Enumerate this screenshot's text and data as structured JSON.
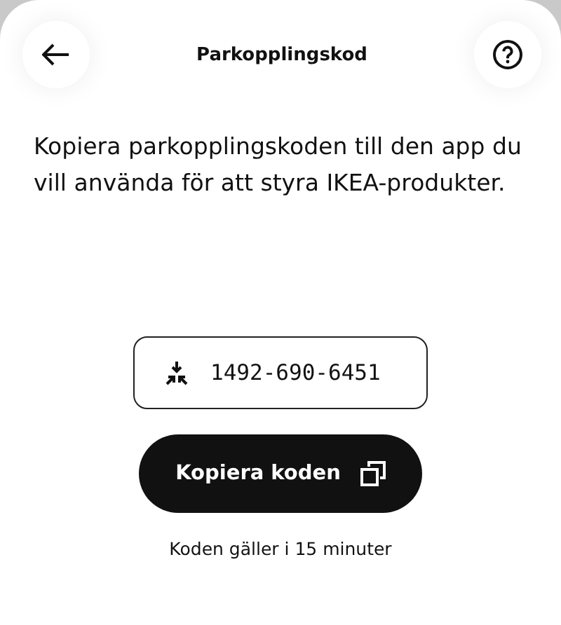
{
  "header": {
    "title": "Parkopplingskod"
  },
  "description": "Kopiera parkopplingskoden till den app du vill använda för att styra IKEA-produkter.",
  "code": "1492-690-6451",
  "copy_button": {
    "label": "Kopiera koden"
  },
  "validity": "Koden gäller i 15 minuter"
}
